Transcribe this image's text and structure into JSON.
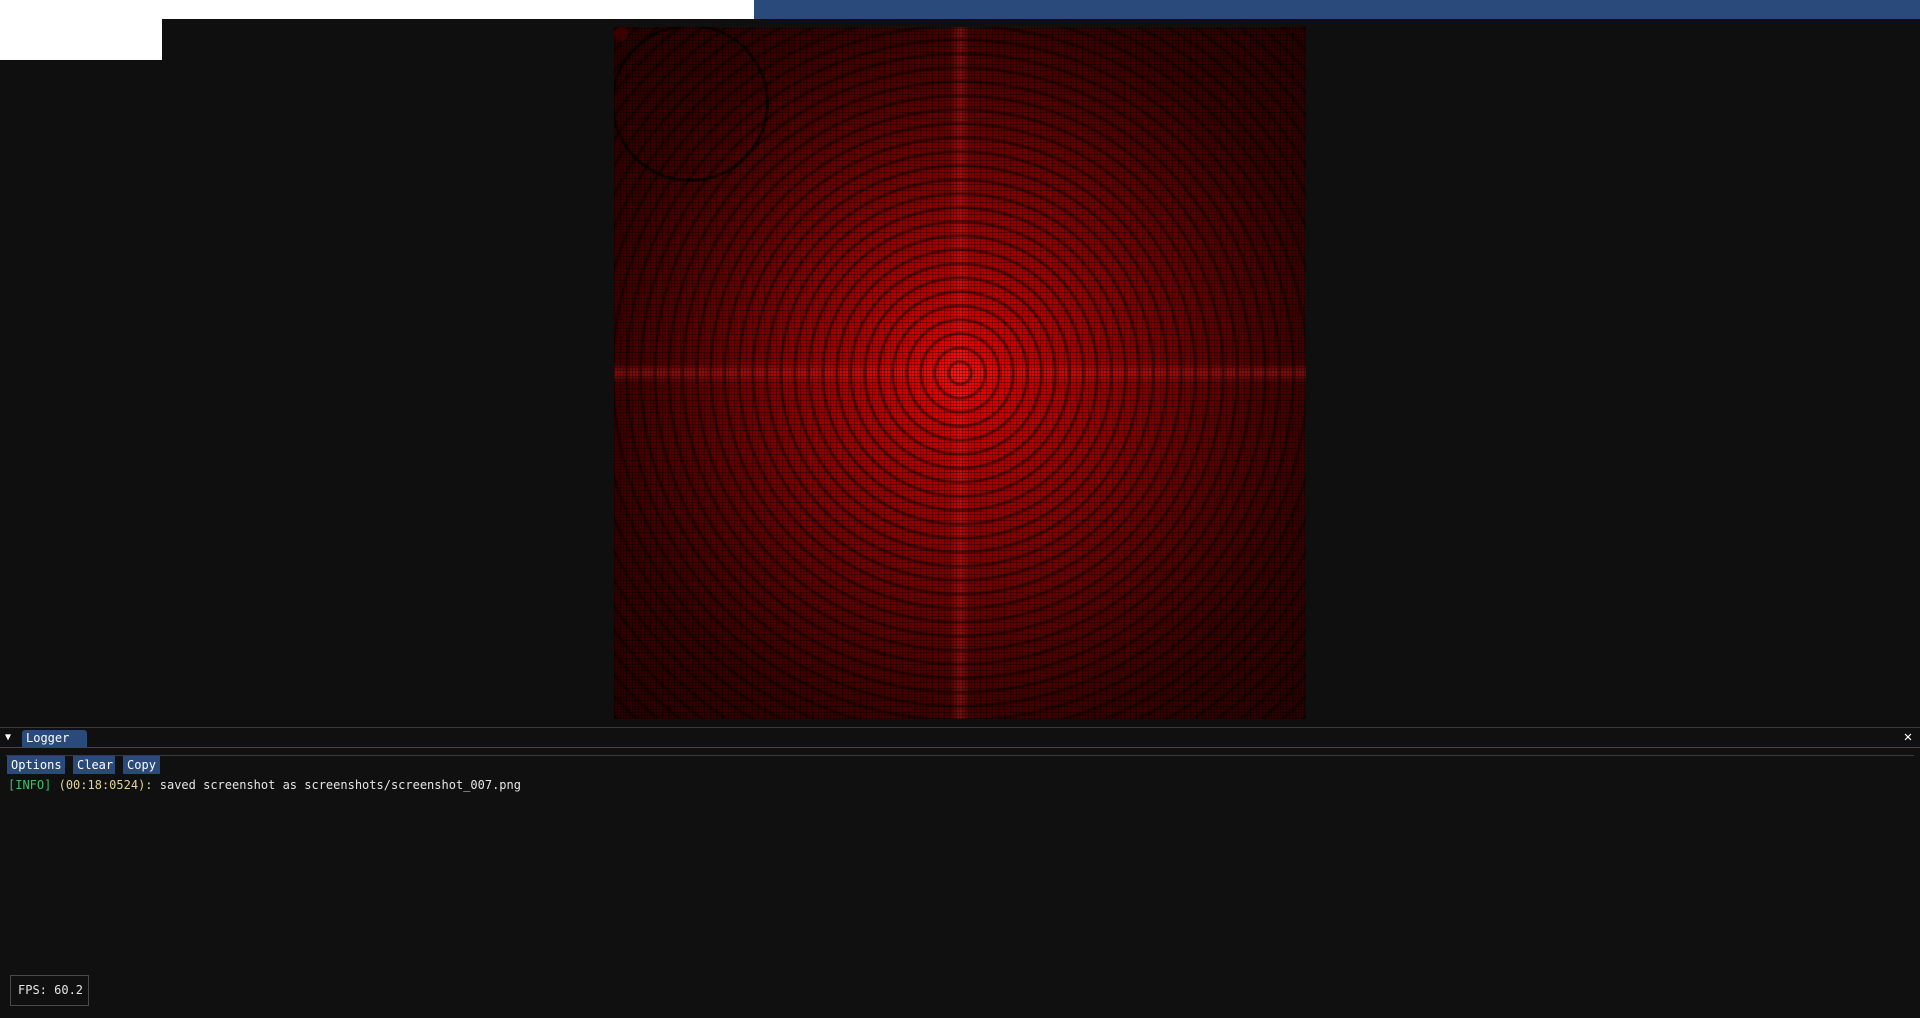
{
  "logger": {
    "tab_label": "Logger",
    "close_glyph": "✕",
    "collapse_glyph": "▼",
    "buttons": {
      "options": "Options",
      "clear": "Clear",
      "copy": "Copy"
    },
    "entries": [
      {
        "level": "[INFO]",
        "time": "(00:18:0524):",
        "message": "saved screenshot as screenshots/screenshot_007.png"
      }
    ]
  },
  "fps": {
    "label": "FPS: 60.2"
  },
  "colors": {
    "accent": "#294a7a",
    "background": "#0f0f0f",
    "info": "#3cbf6a",
    "timestamp": "#e0d49a",
    "image_red": "#e00000"
  },
  "icons": {
    "collapse": "triangle-down-icon",
    "close": "close-icon"
  }
}
